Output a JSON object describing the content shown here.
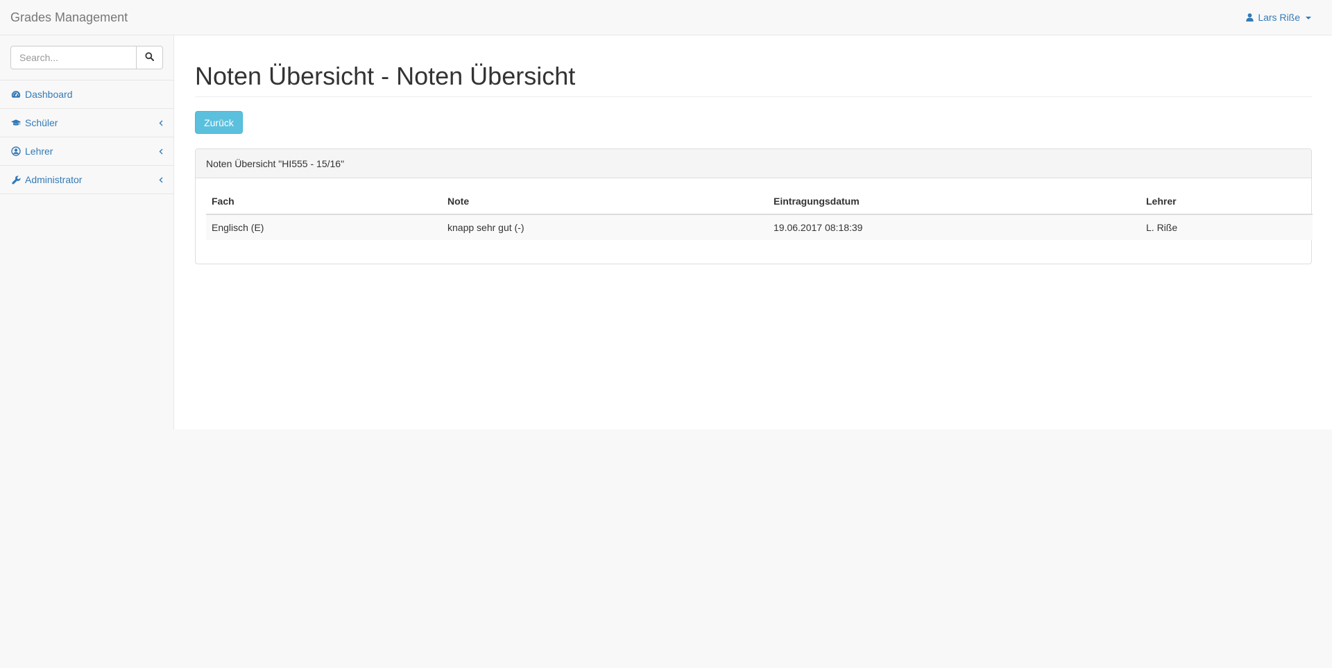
{
  "navbar": {
    "brand": "Grades Management",
    "user_name": "Lars Riße",
    "user_icon": "user-icon"
  },
  "sidebar": {
    "search_placeholder": "Search...",
    "items": [
      {
        "label": "Dashboard",
        "icon": "dashboard-icon",
        "has_submenu": false
      },
      {
        "label": "Schüler",
        "icon": "graduation-cap-icon",
        "has_submenu": true
      },
      {
        "label": "Lehrer",
        "icon": "user-circle-icon",
        "has_submenu": true
      },
      {
        "label": "Administrator",
        "icon": "wrench-icon",
        "has_submenu": true
      }
    ]
  },
  "main": {
    "title": "Noten Übersicht - Noten Übersicht",
    "back_button": "Zurück",
    "panel": {
      "heading": "Noten Übersicht \"HI555 - 15/16\"",
      "columns": [
        "Fach",
        "Note",
        "Eintragungsdatum",
        "Lehrer"
      ],
      "rows": [
        [
          "Englisch (E)",
          "knapp sehr gut (-)",
          "19.06.2017 08:18:39",
          "L. Riße"
        ]
      ]
    }
  },
  "colors": {
    "link": "#337ab7",
    "info_button": "#5bc0de",
    "navbar_bg": "#f8f8f8"
  }
}
